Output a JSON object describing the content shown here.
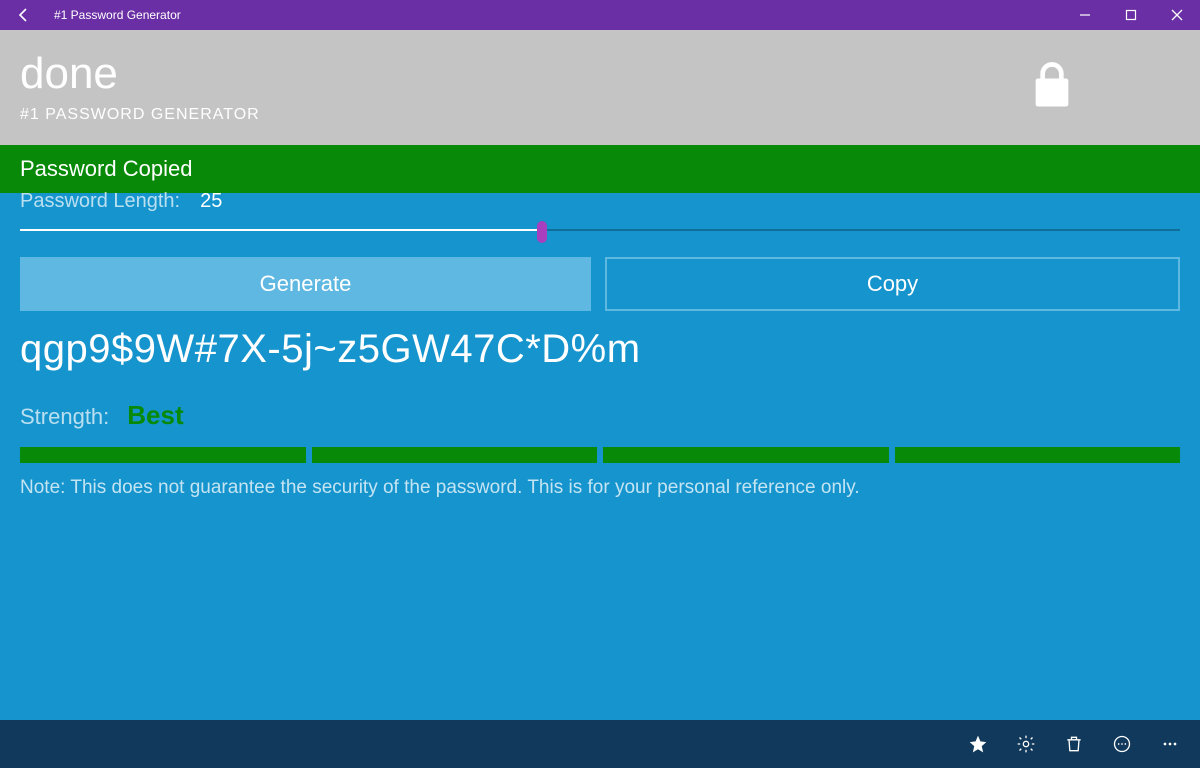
{
  "window": {
    "title": "#1 Password Generator"
  },
  "header": {
    "done": "done",
    "app_title": "#1 PASSWORD GENERATOR"
  },
  "status": {
    "message": "Password Copied"
  },
  "controls": {
    "length_label": "Password Length:",
    "length_value": "25",
    "generate_label": "Generate",
    "copy_label": "Copy"
  },
  "result": {
    "password": "qgp9$9W#7X-5j~z5GW47C*D%m",
    "strength_label": "Strength:",
    "strength_value": "Best",
    "note": "Note: This does not guarantee the security of the password. This is for your personal reference only."
  },
  "colors": {
    "title_bar": "#6b2fa5",
    "header_bg": "#c4c4c4",
    "status_bg": "#088a08",
    "main_bg": "#1594cd",
    "button_fill": "#5fb8e1",
    "slider_thumb": "#a83fbf",
    "command_bar": "#10395c"
  },
  "commandbar_icons": [
    "star",
    "settings",
    "delete",
    "more-circle",
    "more"
  ]
}
